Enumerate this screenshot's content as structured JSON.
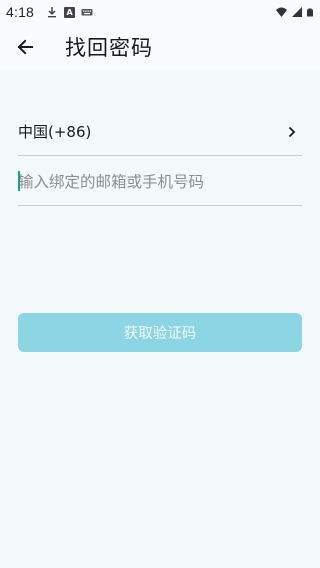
{
  "status_bar": {
    "time": "4:18",
    "left_icons": [
      "download-icon",
      "a-icon",
      "keyboard-icon"
    ],
    "right_icons": [
      "wifi-icon",
      "cell-signal-icon",
      "battery-icon"
    ]
  },
  "header": {
    "back_icon": "arrow-left-icon",
    "title": "找回密码"
  },
  "country": {
    "label": "中国(+86)",
    "chevron_icon": "chevron-right-icon"
  },
  "account_input": {
    "value": "",
    "placeholder": "输入绑定的邮箱或手机号码"
  },
  "get_code_button": {
    "label": "获取验证码",
    "color": "#8bd5e5"
  },
  "colors": {
    "background": "#f4f9fc",
    "bar_background": "#f9fbfe",
    "accent": "#1c9c8a",
    "divider": "#c9ccce"
  }
}
